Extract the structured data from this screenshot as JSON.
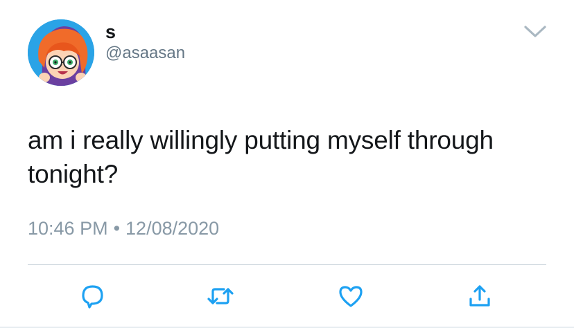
{
  "tweet": {
    "display_name": "s",
    "handle": "@asaasan",
    "text": "am i really willingly putting myself through tonight?",
    "time": "10:46 PM",
    "separator": "•",
    "date": "12/08/2020"
  },
  "icons": {
    "menu": "chevron-down-icon",
    "reply": "reply-icon",
    "retweet": "retweet-icon",
    "like": "heart-icon",
    "share": "share-icon"
  },
  "colors": {
    "text": "#14171a",
    "secondary": "#657786",
    "meta": "#8899a6",
    "icon": "#1da1f2",
    "divider": "#ccd6dd"
  }
}
